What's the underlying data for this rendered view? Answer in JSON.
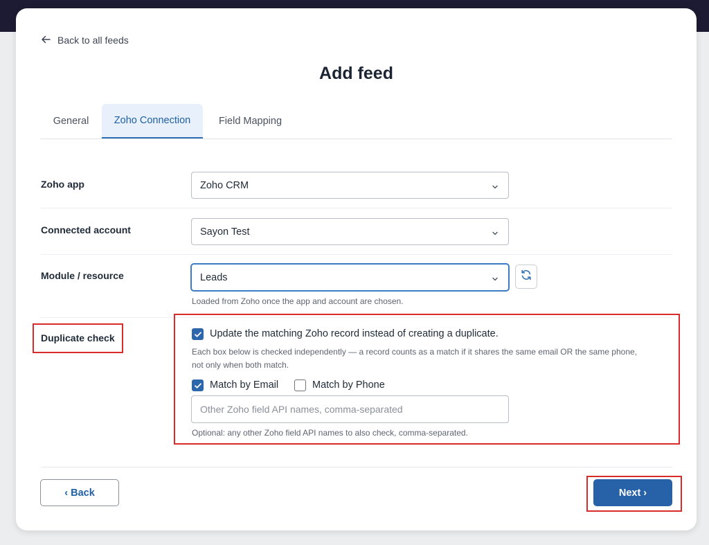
{
  "header": {
    "back_link": "Back to all feeds",
    "title": "Add feed"
  },
  "tabs": [
    {
      "label": "General",
      "active": false
    },
    {
      "label": "Zoho Connection",
      "active": true
    },
    {
      "label": "Field Mapping",
      "active": false
    }
  ],
  "form": {
    "zoho_app": {
      "label": "Zoho app",
      "value": "Zoho CRM"
    },
    "connected_account": {
      "label": "Connected account",
      "value": "Sayon Test"
    },
    "module": {
      "label": "Module / resource",
      "value": "Leads",
      "help": "Loaded from Zoho once the app and account are chosen."
    },
    "duplicate_check": {
      "label": "Duplicate check",
      "update_checkbox": {
        "label": "Update the matching Zoho record instead of creating a duplicate.",
        "checked": true
      },
      "explanation_line1": "Each box below is checked independently — a record counts as a match if it shares the same email OR the same phone,",
      "explanation_line2": "not only when both match.",
      "match_email": {
        "label": "Match by Email",
        "checked": true
      },
      "match_phone": {
        "label": "Match by Phone",
        "checked": false
      },
      "other_fields": {
        "value": "",
        "placeholder": "Other Zoho field API names, comma-separated"
      },
      "optional_help": "Optional: any other Zoho field API names to also check, comma-separated."
    }
  },
  "footer": {
    "back_label": "‹ Back",
    "next_label": "Next ›"
  },
  "colors": {
    "primary": "#2762a8",
    "highlight_box": "#d92a2a",
    "active_tab_bg": "#e8f1fb"
  },
  "icons": {
    "back": "arrow-left-icon",
    "dropdown": "chevron-down-icon",
    "refresh": "refresh-icon",
    "check": "checkmark-icon"
  }
}
